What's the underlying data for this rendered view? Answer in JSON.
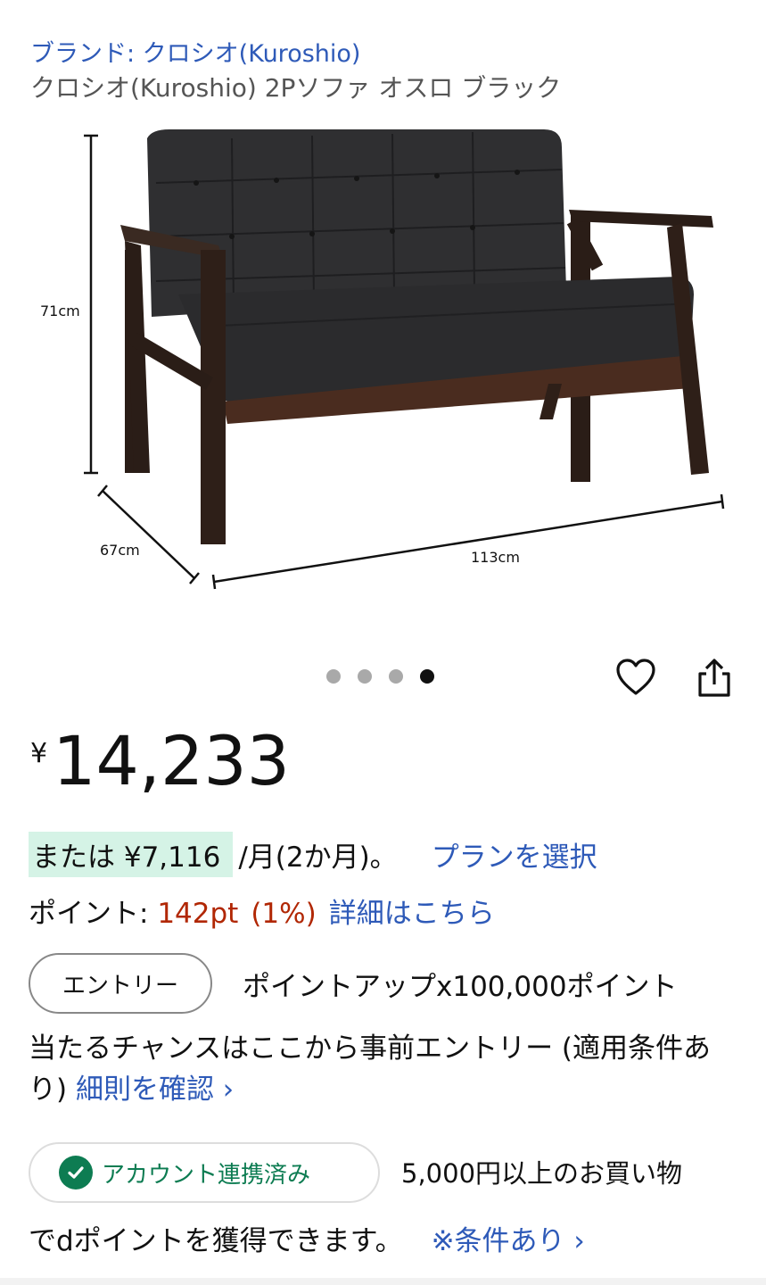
{
  "product": {
    "brand_line": "ブランド: クロシオ(Kuroshio)",
    "title": "クロシオ(Kuroshio) 2Pソファ オスロ ブラック"
  },
  "image": {
    "dimension_height": "71cm",
    "dimension_depth": "67cm",
    "dimension_width": "113cm"
  },
  "carousel": {
    "total": 4,
    "active_index": 4
  },
  "price": {
    "currency": "¥",
    "amount": "14,233"
  },
  "installment": {
    "prefix": "または ¥7,116",
    "suffix": "/月(2か月)。",
    "plan_link": "プランを選択"
  },
  "points": {
    "label": "ポイント: ",
    "value": "142pt",
    "percent": "(1%)",
    "detail_link": "詳細はこちら"
  },
  "entry": {
    "button_label": "エントリー",
    "headline": "ポイントアップx100,000ポイント",
    "body": "当たるチャンスはここから事前エントリー (適用条件あり) ",
    "rules_link": "細則を確認 ›"
  },
  "account": {
    "badge_label": "アカウント連携済み",
    "headline": "5,000円以上のお買い物",
    "body": "でdポイントを獲得できます。",
    "conditions_link": "※条件あり ›"
  },
  "colors": {
    "link": "#2e5ab8",
    "price_red": "#b12704",
    "highlight": "#d5f3e6",
    "check_green": "#0d7c52"
  }
}
